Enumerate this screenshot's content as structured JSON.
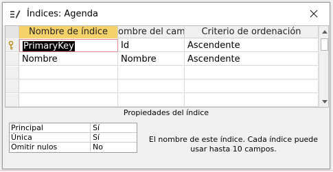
{
  "window": {
    "title": "Índices: Agenda",
    "icon": "index-icon",
    "close_icon": "close-icon"
  },
  "grid": {
    "columns": [
      "Nombre de índice",
      "ombre del camp",
      "Criterio de ordenación"
    ],
    "rows": [
      {
        "index_name": "PrimaryKey",
        "field_name": "Id",
        "sort_order": "Ascendente",
        "primary_key": true
      },
      {
        "index_name": "Nombre",
        "field_name": "Nombre",
        "sort_order": "Ascendente",
        "primary_key": false
      }
    ]
  },
  "properties": {
    "title": "Propiedades del índice",
    "items": [
      {
        "label": "Principal",
        "value": "Sí"
      },
      {
        "label": "Única",
        "value": "Sí"
      },
      {
        "label": "Omitir nulos",
        "value": "No"
      }
    ],
    "help": "El nombre de este índice. Cada índice puede usar hasta 10 campos."
  }
}
